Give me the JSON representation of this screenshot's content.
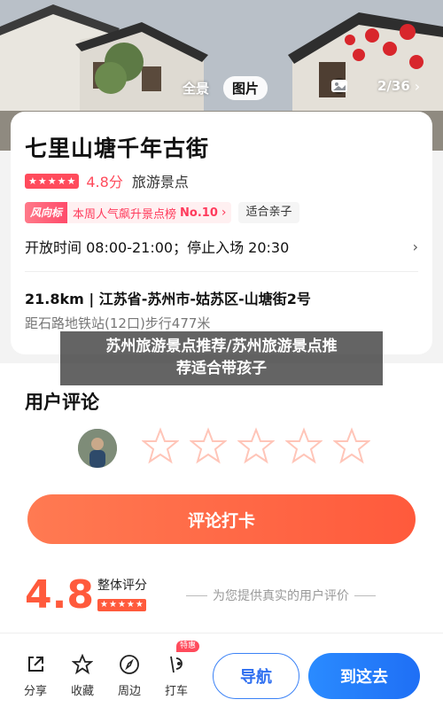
{
  "gallery": {
    "tabs": [
      "全景",
      "图片"
    ],
    "active_tab": "图片",
    "counter": "2/36"
  },
  "poi": {
    "title": "七里山塘千年古街",
    "rating_stars": 5,
    "score": "4.8分",
    "category": "旅游景点",
    "rank_tag": "风向标",
    "rank_text": "本周人气飙升景点榜",
    "rank_no": "No.10",
    "family_tag": "适合亲子",
    "hours": "开放时间 08:00-21:00；停止入场 20:30",
    "address": "21.8km | 江苏省-苏州市-姑苏区-山塘街2号",
    "distance": "距石路地铁站(12口)步行477米"
  },
  "banner": {
    "line1": "苏州旅游景点推荐/苏州旅游景点推",
    "line2": "荐适合带孩子"
  },
  "reviews": {
    "title": "用户评论",
    "empty_star_count": 5,
    "checkin_label": "评论打卡",
    "overall_score": "4.8",
    "overall_label": "整体评分",
    "prompt": "为您提供真实的用户评价"
  },
  "bottom_bar": {
    "share": "分享",
    "favorite": "收藏",
    "nearby": "周边",
    "taxi": "打车",
    "taxi_badge": "特惠",
    "navigate": "导航",
    "go_here": "到这去"
  },
  "colors": {
    "accent_red": "#ff4b5c",
    "accent_orange": "#ff5a3c",
    "accent_blue": "#1f6ff5"
  }
}
